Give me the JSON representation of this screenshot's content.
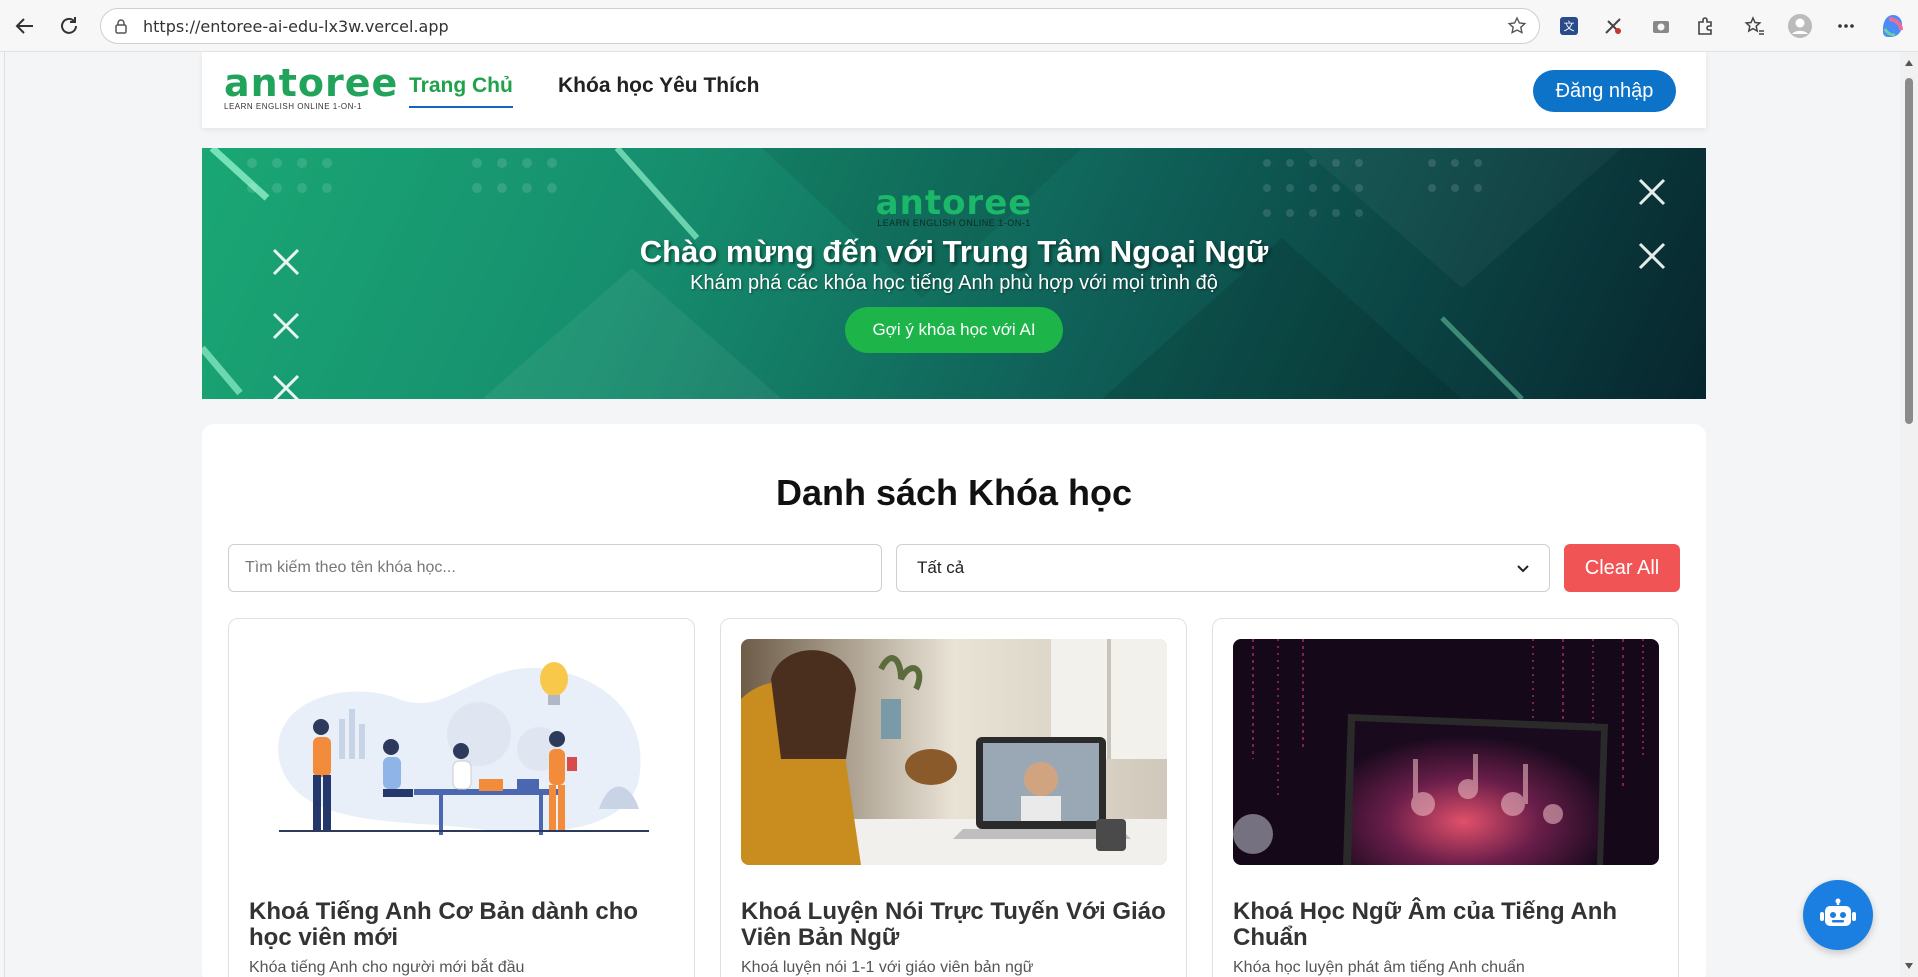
{
  "browser": {
    "url": "https://entoree-ai-edu-lx3w.vercel.app"
  },
  "header": {
    "logo_word": "antoree",
    "logo_tagline": "LEARN ENGLISH ONLINE 1-ON-1",
    "nav": [
      {
        "label": "Trang Chủ",
        "active": true
      },
      {
        "label": "Khóa học Yêu Thích",
        "active": false
      }
    ],
    "login_label": "Đăng nhập"
  },
  "banner": {
    "logo_word": "antoree",
    "logo_tagline": "LEARN ENGLISH ONLINE 1-ON-1",
    "title": "Chào mừng đến với Trung Tâm Ngoại Ngữ",
    "subtitle": "Khám phá các khóa học tiếng Anh phù hợp với mọi trình độ",
    "cta_label": "Gợi ý khóa học với AI"
  },
  "courses": {
    "heading": "Danh sách Khóa học",
    "search_placeholder": "Tìm kiếm theo tên khóa học...",
    "filter_value": "Tất cả",
    "clear_label": "Clear All",
    "items": [
      {
        "title": "Khoá Tiếng Anh Cơ Bản dành cho học viên mới",
        "desc": "Khóa tiếng Anh cho người mới bắt đầu"
      },
      {
        "title": "Khoá Luyện Nói Trực Tuyến Với Giáo Viên Bản Ngữ",
        "desc": "Khoá luyện nói 1-1 với giáo viên bản ngữ"
      },
      {
        "title": "Khoá Học Ngữ Âm của Tiếng Anh Chuẩn",
        "desc": "Khóa học luyện phát âm tiếng Anh chuẩn"
      }
    ]
  },
  "colors": {
    "brand_green": "#21a35b",
    "primary_blue": "#0d73c8",
    "danger_red": "#f05454",
    "cta_green": "#1db44a"
  }
}
